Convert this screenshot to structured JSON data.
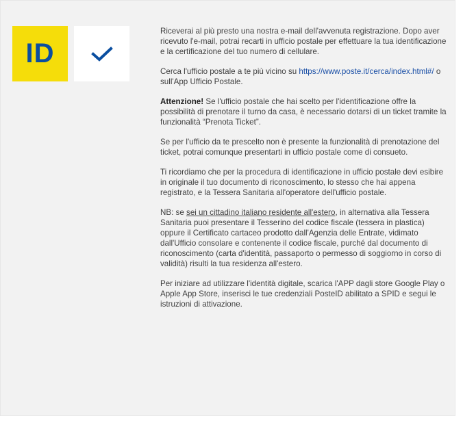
{
  "brand": {
    "logo_text": "ID",
    "logo_bg": "#f5dd0a",
    "logo_fg": "#0a4ea0",
    "check_color": "#0a4ea0",
    "check_icon": "checkmark-icon"
  },
  "paragraphs": {
    "p1": "Riceverai al più presto una nostra e-mail dell'avvenuta registrazione. Dopo aver ricevuto l'e-mail, potrai recarti in ufficio postale per effettuare la tua identificazione e la certificazione del tuo numero di cellulare.",
    "p2_before": "Cerca l'ufficio postale a te più vicino su ",
    "p2_link": "https://www.poste.it/cerca/index.html#/",
    "p2_after": " o sull'App Ufficio Postale.",
    "p3_bold": "Attenzione!",
    "p3_text": " Se l'ufficio postale che hai scelto per l'identificazione offre la possibilità di prenotare il turno da casa, è necessario dotarsi di un ticket tramite la funzionalità “Prenota Ticket”.",
    "p4": "Se per l'ufficio da te prescelto non è presente la funzionalità di prenotazione del ticket, potrai comunque presentarti in ufficio postale come di consueto.",
    "p5": "Ti ricordiamo che per la procedura di identificazione in ufficio postale devi esibire in originale il tuo documento di riconoscimento, lo stesso che hai appena registrato, e la Tessera Sanitaria all'operatore dell'ufficio postale.",
    "p6_before": "NB: se ",
    "p6_underline": "sei un cittadino italiano residente all'estero",
    "p6_after": ", in alternativa alla Tessera Sanitaria puoi presentare il Tesserino del codice fiscale (tessera in plastica) oppure il Certificato cartaceo prodotto dall'Agenzia delle Entrate, vidimato dall'Ufficio consolare e contenente il codice fiscale, purché dal documento di riconoscimento (carta d'identità, passaporto o permesso di soggiorno in corso di validità) risulti la tua residenza all'estero.",
    "p7": "Per iniziare ad utilizzare l'identità digitale, scarica l'APP dagli store Google Play o Apple App Store, inserisci le tue credenziali PosteID abilitato a SPID e segui le istruzioni di attivazione."
  }
}
